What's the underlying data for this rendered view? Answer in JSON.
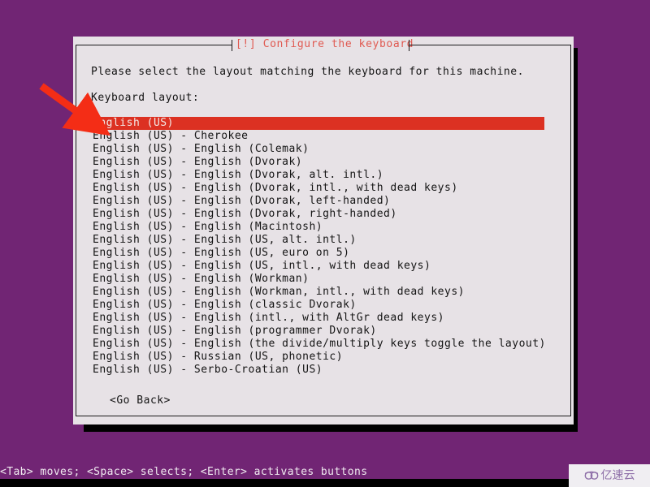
{
  "colors": {
    "background_purple": "#712574",
    "dialog_background": "#e7e2e6",
    "title_red": "#e05a52",
    "highlight_red": "#dc3122",
    "text_black": "#141414",
    "arrow_red": "#f42d16",
    "watermark_purple": "#8e6fa8"
  },
  "dialog": {
    "title": "[!] Configure the keyboard",
    "prompt": "Please select the layout matching the keyboard for this machine.",
    "field_label": "Keyboard layout:",
    "go_back_button": "<Go Back>",
    "selected_index": 0,
    "layouts": [
      "English (US)",
      "English (US) - Cherokee",
      "English (US) - English (Colemak)",
      "English (US) - English (Dvorak)",
      "English (US) - English (Dvorak, alt. intl.)",
      "English (US) - English (Dvorak, intl., with dead keys)",
      "English (US) - English (Dvorak, left-handed)",
      "English (US) - English (Dvorak, right-handed)",
      "English (US) - English (Macintosh)",
      "English (US) - English (US, alt. intl.)",
      "English (US) - English (US, euro on 5)",
      "English (US) - English (US, intl., with dead keys)",
      "English (US) - English (Workman)",
      "English (US) - English (Workman, intl., with dead keys)",
      "English (US) - English (classic Dvorak)",
      "English (US) - English (intl., with AltGr dead keys)",
      "English (US) - English (programmer Dvorak)",
      "English (US) - English (the divide/multiply keys toggle the layout)",
      "English (US) - Russian (US, phonetic)",
      "English (US) - Serbo-Croatian (US)"
    ]
  },
  "help_bar": {
    "text": "<Tab> moves; <Space> selects; <Enter> activates buttons"
  },
  "annotation": {
    "arrow_label": "red-arrow-pointing-to-selected-layout"
  },
  "watermark": {
    "text": "亿速云"
  }
}
